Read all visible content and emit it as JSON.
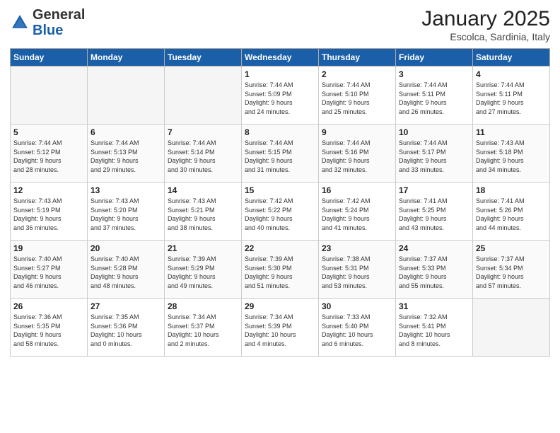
{
  "header": {
    "logo_general": "General",
    "logo_blue": "Blue",
    "month": "January 2025",
    "location": "Escolca, Sardinia, Italy"
  },
  "days_of_week": [
    "Sunday",
    "Monday",
    "Tuesday",
    "Wednesday",
    "Thursday",
    "Friday",
    "Saturday"
  ],
  "weeks": [
    [
      {
        "day": "",
        "info": ""
      },
      {
        "day": "",
        "info": ""
      },
      {
        "day": "",
        "info": ""
      },
      {
        "day": "1",
        "info": "Sunrise: 7:44 AM\nSunset: 5:09 PM\nDaylight: 9 hours\nand 24 minutes."
      },
      {
        "day": "2",
        "info": "Sunrise: 7:44 AM\nSunset: 5:10 PM\nDaylight: 9 hours\nand 25 minutes."
      },
      {
        "day": "3",
        "info": "Sunrise: 7:44 AM\nSunset: 5:11 PM\nDaylight: 9 hours\nand 26 minutes."
      },
      {
        "day": "4",
        "info": "Sunrise: 7:44 AM\nSunset: 5:11 PM\nDaylight: 9 hours\nand 27 minutes."
      }
    ],
    [
      {
        "day": "5",
        "info": "Sunrise: 7:44 AM\nSunset: 5:12 PM\nDaylight: 9 hours\nand 28 minutes."
      },
      {
        "day": "6",
        "info": "Sunrise: 7:44 AM\nSunset: 5:13 PM\nDaylight: 9 hours\nand 29 minutes."
      },
      {
        "day": "7",
        "info": "Sunrise: 7:44 AM\nSunset: 5:14 PM\nDaylight: 9 hours\nand 30 minutes."
      },
      {
        "day": "8",
        "info": "Sunrise: 7:44 AM\nSunset: 5:15 PM\nDaylight: 9 hours\nand 31 minutes."
      },
      {
        "day": "9",
        "info": "Sunrise: 7:44 AM\nSunset: 5:16 PM\nDaylight: 9 hours\nand 32 minutes."
      },
      {
        "day": "10",
        "info": "Sunrise: 7:44 AM\nSunset: 5:17 PM\nDaylight: 9 hours\nand 33 minutes."
      },
      {
        "day": "11",
        "info": "Sunrise: 7:43 AM\nSunset: 5:18 PM\nDaylight: 9 hours\nand 34 minutes."
      }
    ],
    [
      {
        "day": "12",
        "info": "Sunrise: 7:43 AM\nSunset: 5:19 PM\nDaylight: 9 hours\nand 36 minutes."
      },
      {
        "day": "13",
        "info": "Sunrise: 7:43 AM\nSunset: 5:20 PM\nDaylight: 9 hours\nand 37 minutes."
      },
      {
        "day": "14",
        "info": "Sunrise: 7:43 AM\nSunset: 5:21 PM\nDaylight: 9 hours\nand 38 minutes."
      },
      {
        "day": "15",
        "info": "Sunrise: 7:42 AM\nSunset: 5:22 PM\nDaylight: 9 hours\nand 40 minutes."
      },
      {
        "day": "16",
        "info": "Sunrise: 7:42 AM\nSunset: 5:24 PM\nDaylight: 9 hours\nand 41 minutes."
      },
      {
        "day": "17",
        "info": "Sunrise: 7:41 AM\nSunset: 5:25 PM\nDaylight: 9 hours\nand 43 minutes."
      },
      {
        "day": "18",
        "info": "Sunrise: 7:41 AM\nSunset: 5:26 PM\nDaylight: 9 hours\nand 44 minutes."
      }
    ],
    [
      {
        "day": "19",
        "info": "Sunrise: 7:40 AM\nSunset: 5:27 PM\nDaylight: 9 hours\nand 46 minutes."
      },
      {
        "day": "20",
        "info": "Sunrise: 7:40 AM\nSunset: 5:28 PM\nDaylight: 9 hours\nand 48 minutes."
      },
      {
        "day": "21",
        "info": "Sunrise: 7:39 AM\nSunset: 5:29 PM\nDaylight: 9 hours\nand 49 minutes."
      },
      {
        "day": "22",
        "info": "Sunrise: 7:39 AM\nSunset: 5:30 PM\nDaylight: 9 hours\nand 51 minutes."
      },
      {
        "day": "23",
        "info": "Sunrise: 7:38 AM\nSunset: 5:31 PM\nDaylight: 9 hours\nand 53 minutes."
      },
      {
        "day": "24",
        "info": "Sunrise: 7:37 AM\nSunset: 5:33 PM\nDaylight: 9 hours\nand 55 minutes."
      },
      {
        "day": "25",
        "info": "Sunrise: 7:37 AM\nSunset: 5:34 PM\nDaylight: 9 hours\nand 57 minutes."
      }
    ],
    [
      {
        "day": "26",
        "info": "Sunrise: 7:36 AM\nSunset: 5:35 PM\nDaylight: 9 hours\nand 58 minutes."
      },
      {
        "day": "27",
        "info": "Sunrise: 7:35 AM\nSunset: 5:36 PM\nDaylight: 10 hours\nand 0 minutes."
      },
      {
        "day": "28",
        "info": "Sunrise: 7:34 AM\nSunset: 5:37 PM\nDaylight: 10 hours\nand 2 minutes."
      },
      {
        "day": "29",
        "info": "Sunrise: 7:34 AM\nSunset: 5:39 PM\nDaylight: 10 hours\nand 4 minutes."
      },
      {
        "day": "30",
        "info": "Sunrise: 7:33 AM\nSunset: 5:40 PM\nDaylight: 10 hours\nand 6 minutes."
      },
      {
        "day": "31",
        "info": "Sunrise: 7:32 AM\nSunset: 5:41 PM\nDaylight: 10 hours\nand 8 minutes."
      },
      {
        "day": "",
        "info": ""
      }
    ]
  ]
}
